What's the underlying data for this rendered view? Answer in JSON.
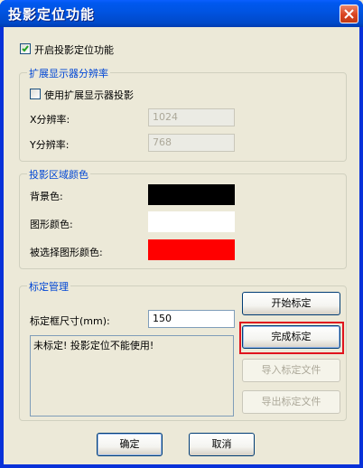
{
  "window": {
    "title": "投影定位功能"
  },
  "enable_projection": {
    "label": "开启投影定位功能",
    "checked": true
  },
  "extended_display": {
    "group_title": "扩展显示器分辨率",
    "use_projection": {
      "label": "使用扩展显示器投影",
      "checked": false
    },
    "x_resolution": {
      "label": "X分辨率:",
      "value": "1024"
    },
    "y_resolution": {
      "label": "Y分辨率:",
      "value": "768"
    }
  },
  "projection_colors": {
    "group_title": "投影区域颜色",
    "background": {
      "label": "背景色:",
      "color": "#000000"
    },
    "shape": {
      "label": "图形颜色:",
      "color": "#ffffff"
    },
    "selected_shape": {
      "label": "被选择图形颜色:",
      "color": "#ff0000"
    }
  },
  "calibration": {
    "group_title": "标定管理",
    "frame_size": {
      "label": "标定框尺寸(mm):",
      "value": "150"
    },
    "status_text": "未标定! 投影定位不能使用!",
    "start_button": "开始标定",
    "finish_button": "完成标定",
    "import_button": "导入标定文件",
    "export_button": "导出标定文件"
  },
  "footer": {
    "ok_button": "确定",
    "cancel_button": "取消"
  },
  "colors": {
    "titlebar": "#0054e3",
    "group_title": "#0046d5",
    "highlight": "#e0141e"
  }
}
